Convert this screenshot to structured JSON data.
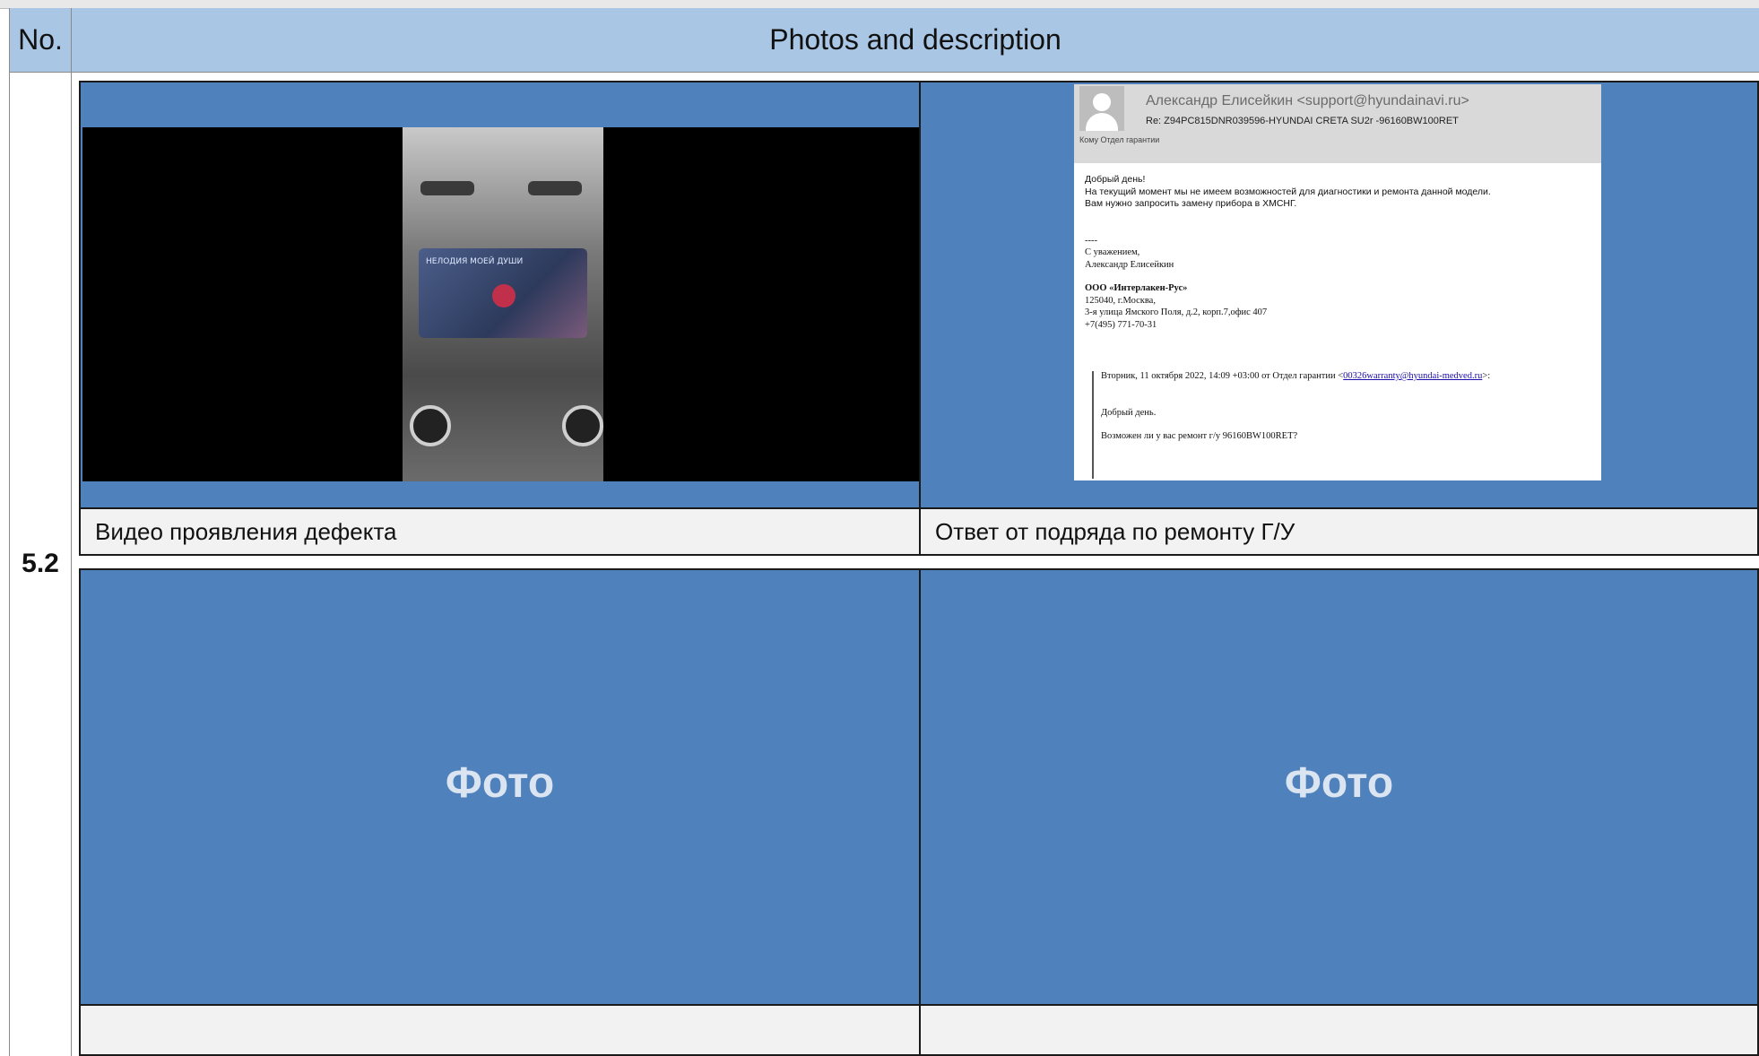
{
  "header": {
    "no_label": "No.",
    "title": "Photos and description"
  },
  "row_number": "5.2",
  "captions": {
    "video": "Видео проявления дефекта",
    "email": "Ответ от подряда по ремонту Г/У",
    "bottom_left": "",
    "bottom_right": ""
  },
  "placeholders": {
    "left": "Фото",
    "right": "Фото"
  },
  "email": {
    "sender": "Александр Елисейкин <support@hyundainavi.ru>",
    "subject": "Re: Z94PC815DNR039596-HYUNDAI CRETA SU2r -96160BW100RET",
    "to_label": "Кому   Отдел гарантии",
    "greeting": "Добрый день!",
    "line1": "На текущий момент мы не имеем возможностей для диагностики и ремонта данной модели.",
    "line2": "Вам нужно запросить замену прибора в ХМСНГ.",
    "dashes": "----",
    "regards": "С уважением,",
    "name": "Александр Елисейкин",
    "company": "ООО «Интерлакен-Рус»",
    "addr1": "125040, г.Москва,",
    "addr2": "3-я улица Ямского Поля, д.2, корп.7,офис 407",
    "phone": "+7(495) 771-70-31",
    "quote_header": "Вторник, 11 октября 2022, 14:09 +03:00 от Отдел гарантии <",
    "quote_link": "00326warranty@hyundai-medved.ru",
    "quote_tail": ">:",
    "quote_greeting": "Добрый день.",
    "quote_question": "Возможен ли у вас ремонт г/у 96160BW100RET?"
  },
  "video_screen_text": "НЕЛОДИЯ МОЕЙ ДУШИ"
}
